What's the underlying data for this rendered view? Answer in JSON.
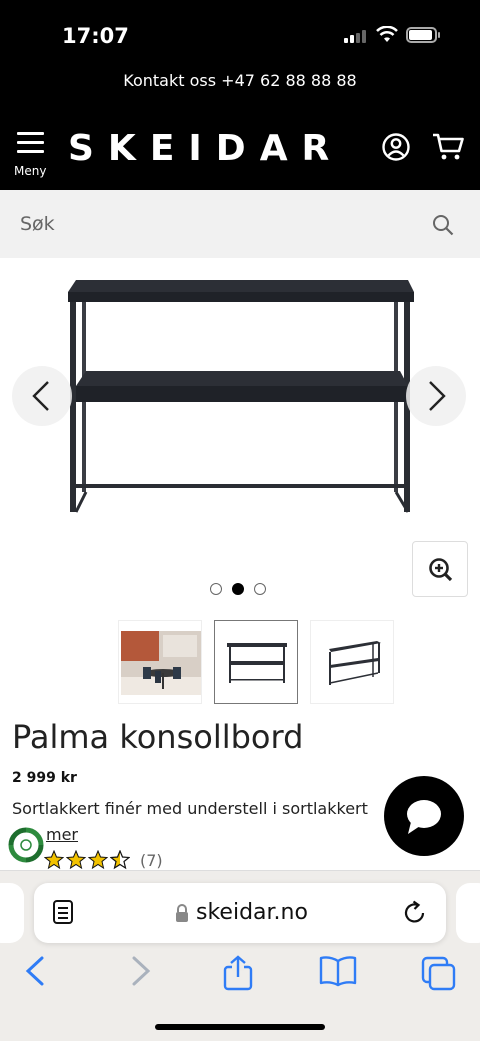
{
  "status_bar": {
    "time": "17:07"
  },
  "header": {
    "contact": "Kontakt oss +47 62 88 88 88",
    "logo": "SKEIDAR",
    "menu_label": "Meny"
  },
  "search": {
    "placeholder": "Søk"
  },
  "product": {
    "title": "Palma konsollbord",
    "price": "2 999 kr",
    "description": "Sortlakkert finér med understell i sortlakkert",
    "more_link": "mer",
    "rating_value": 3.5,
    "rating_max": 5,
    "review_count": "(7)",
    "gallery_dots": 3,
    "gallery_active_index": 1,
    "thumbnails": [
      "room-scene",
      "table-front",
      "table-angle"
    ]
  },
  "browser": {
    "url": "skeidar.no"
  },
  "colors": {
    "header_bg": "#000000",
    "search_bg": "#f1f1f1",
    "ios_blue": "#2f7cf6"
  }
}
